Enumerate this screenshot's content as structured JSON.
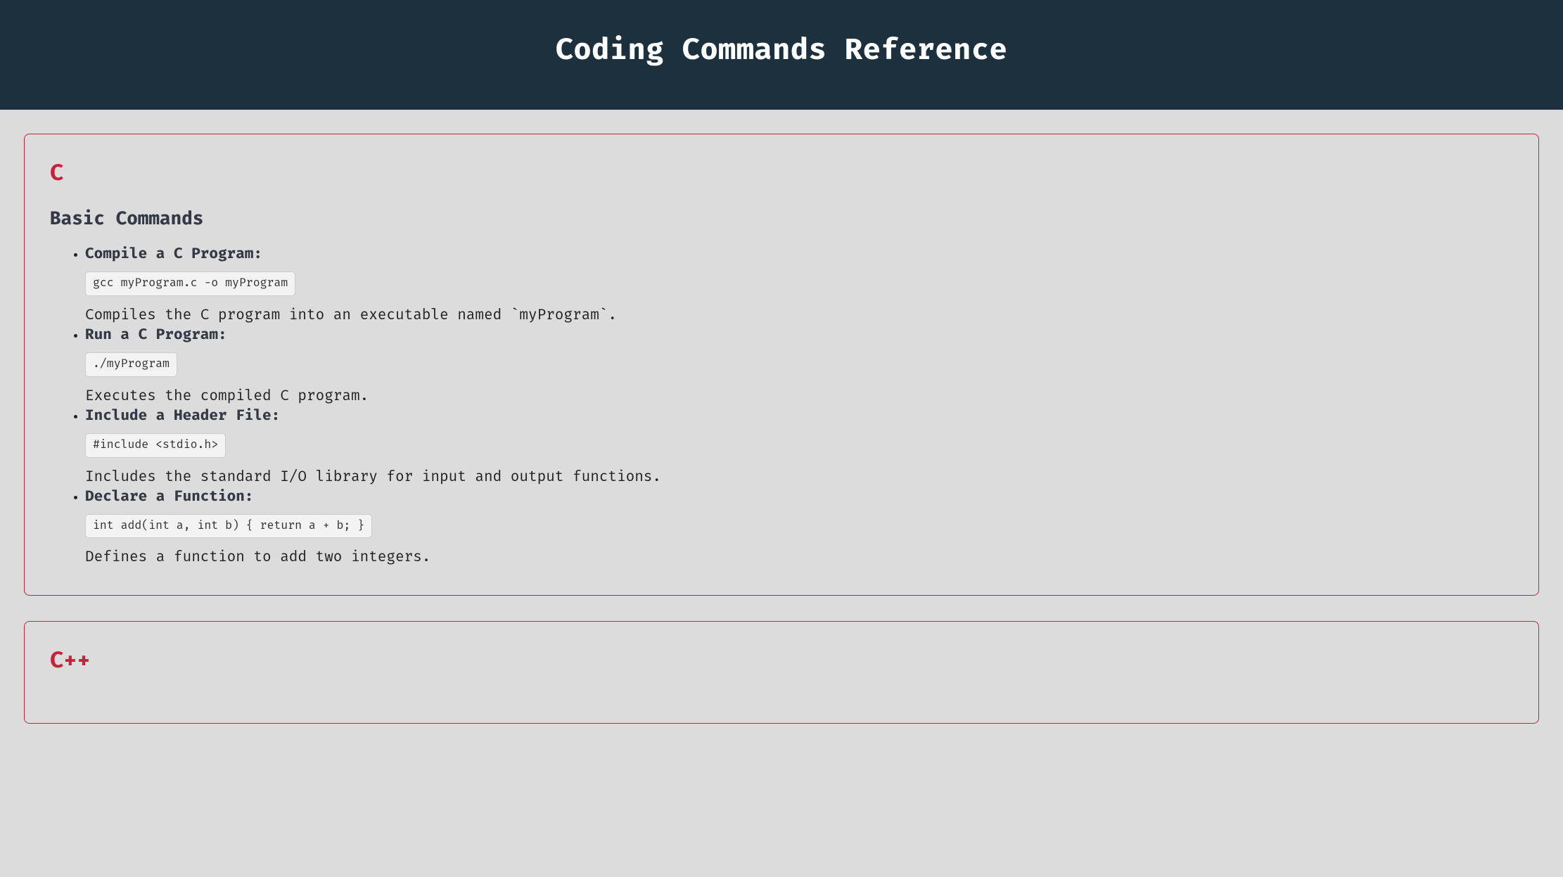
{
  "header": {
    "title": "Coding Commands Reference"
  },
  "sections": [
    {
      "lang": "C",
      "subhead": "Basic Commands",
      "items": [
        {
          "title": "Compile a C Program:",
          "code": "gcc myProgram.c -o myProgram",
          "desc": "Compiles the C program into an executable named `myProgram`."
        },
        {
          "title": "Run a C Program:",
          "code": "./myProgram",
          "desc": "Executes the compiled C program."
        },
        {
          "title": "Include a Header File:",
          "code": "#include <stdio.h>",
          "desc": "Includes the standard I/O library for input and output functions."
        },
        {
          "title": "Declare a Function:",
          "code": "int add(int a, int b) { return a + b; }",
          "desc": "Defines a function to add two integers."
        }
      ]
    },
    {
      "lang": "C++",
      "subhead": "",
      "items": []
    }
  ]
}
